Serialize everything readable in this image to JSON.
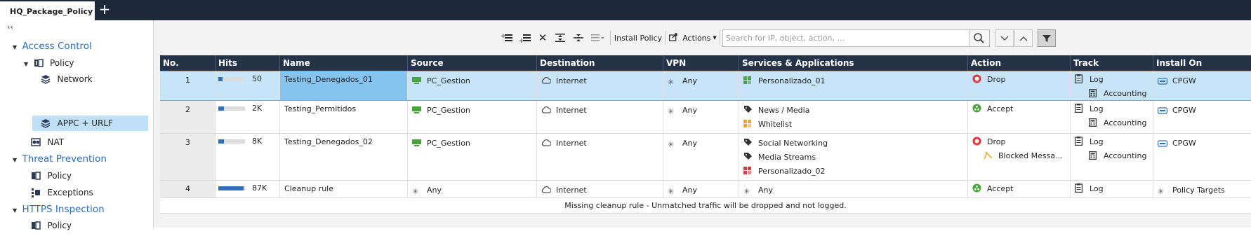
{
  "tabs": {
    "active_label": "HQ_Package_Policy",
    "add_label": "+"
  },
  "sidebar": {
    "collapse_label": "‹‹",
    "sections": [
      {
        "label": "Access Control",
        "items": [
          "Policy",
          "Network",
          "APPC + URLF",
          "NAT"
        ]
      },
      {
        "label": "Threat Prevention",
        "items": [
          "Policy",
          "Exceptions"
        ]
      },
      {
        "label": "HTTPS Inspection",
        "items": [
          "Policy"
        ]
      }
    ],
    "selected_item": "APPC + URLF"
  },
  "toolbar": {
    "install_policy_label": "Install Policy",
    "actions_label": "Actions",
    "search_placeholder": "Search for IP, object, action, ..."
  },
  "table": {
    "columns": [
      "No.",
      "Hits",
      "Name",
      "Source",
      "Destination",
      "VPN",
      "Services & Applications",
      "Action",
      "Track",
      "Install On"
    ],
    "rows": [
      {
        "no": "1",
        "hits_label": "50",
        "hits_fraction": 0.15,
        "name": "Testing_Denegados_01",
        "source": "PC_Gestion",
        "destination": "Internet",
        "vpn": "Any",
        "services": [
          "Personalizado_01"
        ],
        "action": "Drop",
        "action_extra": "",
        "track": "Log",
        "track_extra": "Accounting",
        "install_on": "CPGW"
      },
      {
        "no": "2",
        "hits_label": "2K",
        "hits_fraction": 0.2,
        "name": "Testing_Permitidos",
        "source": "PC_Gestion",
        "destination": "Internet",
        "vpn": "Any",
        "services": [
          "News / Media",
          "Whitelist"
        ],
        "action": "Accept",
        "action_extra": "",
        "track": "Log",
        "track_extra": "Accounting",
        "install_on": "CPGW"
      },
      {
        "no": "3",
        "hits_label": "8K",
        "hits_fraction": 0.2,
        "name": "Testing_Denegados_02",
        "source": "PC_Gestion",
        "destination": "Internet",
        "vpn": "Any",
        "services": [
          "Social Networking",
          "Media Streams",
          "Personalizado_02"
        ],
        "action": "Drop",
        "action_extra": "Blocked Messa...",
        "track": "Log",
        "track_extra": "Accounting",
        "install_on": "CPGW"
      },
      {
        "no": "4",
        "hits_label": "87K",
        "hits_fraction": 0.95,
        "name": "Cleanup rule",
        "source": "Any",
        "destination": "Internet",
        "vpn": "Any",
        "services": [
          "Any"
        ],
        "action": "Accept",
        "action_extra": "",
        "track": "Log",
        "track_extra": "",
        "install_on": "Policy Targets"
      }
    ],
    "footer_message": "Missing cleanup rule - Unmatched traffic will be dropped and not logged."
  },
  "colors": {
    "header_bg": "#253349",
    "accent": "#2f6fb3",
    "selected_row": "#c7e4f9",
    "selected_name": "#86c4f0",
    "drop": "#e0383e",
    "accept": "#4aa33b"
  }
}
